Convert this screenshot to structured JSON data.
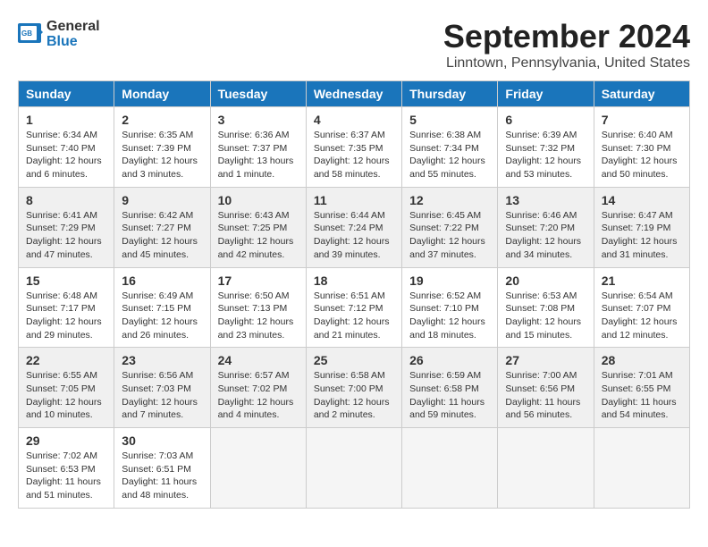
{
  "header": {
    "logo_line1": "General",
    "logo_line2": "Blue",
    "month_title": "September 2024",
    "location": "Linntown, Pennsylvania, United States"
  },
  "days_of_week": [
    "Sunday",
    "Monday",
    "Tuesday",
    "Wednesday",
    "Thursday",
    "Friday",
    "Saturday"
  ],
  "weeks": [
    {
      "shaded": false,
      "days": [
        {
          "num": "1",
          "sunrise": "Sunrise: 6:34 AM",
          "sunset": "Sunset: 7:40 PM",
          "daylight": "Daylight: 12 hours and 6 minutes."
        },
        {
          "num": "2",
          "sunrise": "Sunrise: 6:35 AM",
          "sunset": "Sunset: 7:39 PM",
          "daylight": "Daylight: 12 hours and 3 minutes."
        },
        {
          "num": "3",
          "sunrise": "Sunrise: 6:36 AM",
          "sunset": "Sunset: 7:37 PM",
          "daylight": "Daylight: 13 hours and 1 minute."
        },
        {
          "num": "4",
          "sunrise": "Sunrise: 6:37 AM",
          "sunset": "Sunset: 7:35 PM",
          "daylight": "Daylight: 12 hours and 58 minutes."
        },
        {
          "num": "5",
          "sunrise": "Sunrise: 6:38 AM",
          "sunset": "Sunset: 7:34 PM",
          "daylight": "Daylight: 12 hours and 55 minutes."
        },
        {
          "num": "6",
          "sunrise": "Sunrise: 6:39 AM",
          "sunset": "Sunset: 7:32 PM",
          "daylight": "Daylight: 12 hours and 53 minutes."
        },
        {
          "num": "7",
          "sunrise": "Sunrise: 6:40 AM",
          "sunset": "Sunset: 7:30 PM",
          "daylight": "Daylight: 12 hours and 50 minutes."
        }
      ]
    },
    {
      "shaded": true,
      "days": [
        {
          "num": "8",
          "sunrise": "Sunrise: 6:41 AM",
          "sunset": "Sunset: 7:29 PM",
          "daylight": "Daylight: 12 hours and 47 minutes."
        },
        {
          "num": "9",
          "sunrise": "Sunrise: 6:42 AM",
          "sunset": "Sunset: 7:27 PM",
          "daylight": "Daylight: 12 hours and 45 minutes."
        },
        {
          "num": "10",
          "sunrise": "Sunrise: 6:43 AM",
          "sunset": "Sunset: 7:25 PM",
          "daylight": "Daylight: 12 hours and 42 minutes."
        },
        {
          "num": "11",
          "sunrise": "Sunrise: 6:44 AM",
          "sunset": "Sunset: 7:24 PM",
          "daylight": "Daylight: 12 hours and 39 minutes."
        },
        {
          "num": "12",
          "sunrise": "Sunrise: 6:45 AM",
          "sunset": "Sunset: 7:22 PM",
          "daylight": "Daylight: 12 hours and 37 minutes."
        },
        {
          "num": "13",
          "sunrise": "Sunrise: 6:46 AM",
          "sunset": "Sunset: 7:20 PM",
          "daylight": "Daylight: 12 hours and 34 minutes."
        },
        {
          "num": "14",
          "sunrise": "Sunrise: 6:47 AM",
          "sunset": "Sunset: 7:19 PM",
          "daylight": "Daylight: 12 hours and 31 minutes."
        }
      ]
    },
    {
      "shaded": false,
      "days": [
        {
          "num": "15",
          "sunrise": "Sunrise: 6:48 AM",
          "sunset": "Sunset: 7:17 PM",
          "daylight": "Daylight: 12 hours and 29 minutes."
        },
        {
          "num": "16",
          "sunrise": "Sunrise: 6:49 AM",
          "sunset": "Sunset: 7:15 PM",
          "daylight": "Daylight: 12 hours and 26 minutes."
        },
        {
          "num": "17",
          "sunrise": "Sunrise: 6:50 AM",
          "sunset": "Sunset: 7:13 PM",
          "daylight": "Daylight: 12 hours and 23 minutes."
        },
        {
          "num": "18",
          "sunrise": "Sunrise: 6:51 AM",
          "sunset": "Sunset: 7:12 PM",
          "daylight": "Daylight: 12 hours and 21 minutes."
        },
        {
          "num": "19",
          "sunrise": "Sunrise: 6:52 AM",
          "sunset": "Sunset: 7:10 PM",
          "daylight": "Daylight: 12 hours and 18 minutes."
        },
        {
          "num": "20",
          "sunrise": "Sunrise: 6:53 AM",
          "sunset": "Sunset: 7:08 PM",
          "daylight": "Daylight: 12 hours and 15 minutes."
        },
        {
          "num": "21",
          "sunrise": "Sunrise: 6:54 AM",
          "sunset": "Sunset: 7:07 PM",
          "daylight": "Daylight: 12 hours and 12 minutes."
        }
      ]
    },
    {
      "shaded": true,
      "days": [
        {
          "num": "22",
          "sunrise": "Sunrise: 6:55 AM",
          "sunset": "Sunset: 7:05 PM",
          "daylight": "Daylight: 12 hours and 10 minutes."
        },
        {
          "num": "23",
          "sunrise": "Sunrise: 6:56 AM",
          "sunset": "Sunset: 7:03 PM",
          "daylight": "Daylight: 12 hours and 7 minutes."
        },
        {
          "num": "24",
          "sunrise": "Sunrise: 6:57 AM",
          "sunset": "Sunset: 7:02 PM",
          "daylight": "Daylight: 12 hours and 4 minutes."
        },
        {
          "num": "25",
          "sunrise": "Sunrise: 6:58 AM",
          "sunset": "Sunset: 7:00 PM",
          "daylight": "Daylight: 12 hours and 2 minutes."
        },
        {
          "num": "26",
          "sunrise": "Sunrise: 6:59 AM",
          "sunset": "Sunset: 6:58 PM",
          "daylight": "Daylight: 11 hours and 59 minutes."
        },
        {
          "num": "27",
          "sunrise": "Sunrise: 7:00 AM",
          "sunset": "Sunset: 6:56 PM",
          "daylight": "Daylight: 11 hours and 56 minutes."
        },
        {
          "num": "28",
          "sunrise": "Sunrise: 7:01 AM",
          "sunset": "Sunset: 6:55 PM",
          "daylight": "Daylight: 11 hours and 54 minutes."
        }
      ]
    },
    {
      "shaded": false,
      "days": [
        {
          "num": "29",
          "sunrise": "Sunrise: 7:02 AM",
          "sunset": "Sunset: 6:53 PM",
          "daylight": "Daylight: 11 hours and 51 minutes."
        },
        {
          "num": "30",
          "sunrise": "Sunrise: 7:03 AM",
          "sunset": "Sunset: 6:51 PM",
          "daylight": "Daylight: 11 hours and 48 minutes."
        },
        {
          "num": "",
          "sunrise": "",
          "sunset": "",
          "daylight": ""
        },
        {
          "num": "",
          "sunrise": "",
          "sunset": "",
          "daylight": ""
        },
        {
          "num": "",
          "sunrise": "",
          "sunset": "",
          "daylight": ""
        },
        {
          "num": "",
          "sunrise": "",
          "sunset": "",
          "daylight": ""
        },
        {
          "num": "",
          "sunrise": "",
          "sunset": "",
          "daylight": ""
        }
      ]
    }
  ]
}
